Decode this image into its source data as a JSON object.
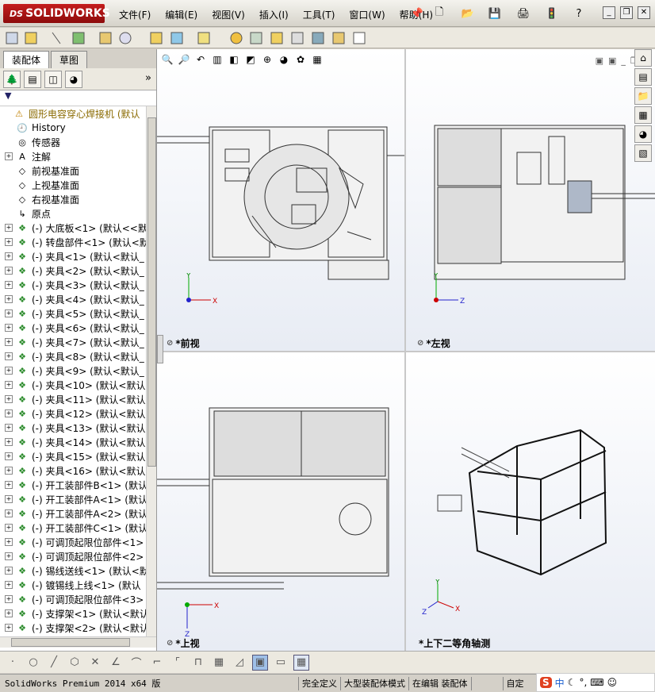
{
  "app": {
    "logo_mark": "DS",
    "logo_text": "SOLIDWORKS"
  },
  "menu": [
    {
      "label": "文件(F)"
    },
    {
      "label": "编辑(E)"
    },
    {
      "label": "视图(V)"
    },
    {
      "label": "插入(I)"
    },
    {
      "label": "工具(T)"
    },
    {
      "label": "窗口(W)"
    },
    {
      "label": "帮助(H)"
    }
  ],
  "fm": {
    "tabs": [
      {
        "label": "装配体"
      },
      {
        "label": "草图"
      }
    ],
    "more": "»",
    "filter": "▼"
  },
  "tree": [
    {
      "label": "圆形电容穿心焊接机  (默认",
      "icon": "assembly-warning-icon",
      "exp": false,
      "root": true
    },
    {
      "label": "History",
      "icon": "history-icon",
      "exp": false
    },
    {
      "label": "传感器",
      "icon": "sensor-icon",
      "exp": false
    },
    {
      "label": "注解",
      "icon": "annotation-icon",
      "exp": true
    },
    {
      "label": "前视基准面",
      "icon": "plane-icon",
      "exp": false
    },
    {
      "label": "上视基准面",
      "icon": "plane-icon",
      "exp": false
    },
    {
      "label": "右视基准面",
      "icon": "plane-icon",
      "exp": false
    },
    {
      "label": "原点",
      "icon": "origin-icon",
      "exp": false
    },
    {
      "label": "(-) 大底板<1> (默认<<默",
      "icon": "part-icon",
      "exp": true
    },
    {
      "label": "(-) 转盘部件<1> (默认<默",
      "icon": "part-icon",
      "exp": true
    },
    {
      "label": "(-) 夹具<1> (默认<默认_",
      "icon": "part-icon",
      "exp": true
    },
    {
      "label": "(-) 夹具<2> (默认<默认_",
      "icon": "part-icon",
      "exp": true
    },
    {
      "label": "(-) 夹具<3> (默认<默认_",
      "icon": "part-icon",
      "exp": true
    },
    {
      "label": "(-) 夹具<4> (默认<默认_",
      "icon": "part-icon",
      "exp": true
    },
    {
      "label": "(-) 夹具<5> (默认<默认_",
      "icon": "part-icon",
      "exp": true
    },
    {
      "label": "(-) 夹具<6> (默认<默认_",
      "icon": "part-icon",
      "exp": true
    },
    {
      "label": "(-) 夹具<7> (默认<默认_",
      "icon": "part-icon",
      "exp": true
    },
    {
      "label": "(-) 夹具<8> (默认<默认_",
      "icon": "part-icon",
      "exp": true
    },
    {
      "label": "(-) 夹具<9> (默认<默认_",
      "icon": "part-icon",
      "exp": true
    },
    {
      "label": "(-) 夹具<10> (默认<默认",
      "icon": "part-icon",
      "exp": true
    },
    {
      "label": "(-) 夹具<11> (默认<默认",
      "icon": "part-icon",
      "exp": true
    },
    {
      "label": "(-) 夹具<12> (默认<默认",
      "icon": "part-icon",
      "exp": true
    },
    {
      "label": "(-) 夹具<13> (默认<默认",
      "icon": "part-icon",
      "exp": true
    },
    {
      "label": "(-) 夹具<14> (默认<默认",
      "icon": "part-icon",
      "exp": true
    },
    {
      "label": "(-) 夹具<15> (默认<默认",
      "icon": "part-icon",
      "exp": true
    },
    {
      "label": "(-) 夹具<16> (默认<默认",
      "icon": "part-icon",
      "exp": true
    },
    {
      "label": "(-) 开工装部件B<1> (默认",
      "icon": "part-icon",
      "exp": true
    },
    {
      "label": "(-) 开工装部件A<1> (默认",
      "icon": "part-icon",
      "exp": true
    },
    {
      "label": "(-) 开工装部件A<2> (默认",
      "icon": "part-icon",
      "exp": true
    },
    {
      "label": "(-) 开工装部件C<1> (默认",
      "icon": "part-icon",
      "exp": true
    },
    {
      "label": "(-) 可调顶起限位部件<1>",
      "icon": "part-icon",
      "exp": true
    },
    {
      "label": "(-) 可调顶起限位部件<2>",
      "icon": "part-icon",
      "exp": true
    },
    {
      "label": "(-) 锡线送线<1> (默认<默",
      "icon": "part-icon",
      "exp": true
    },
    {
      "label": "(-) 镀锡线上线<1> (默认",
      "icon": "part-icon",
      "exp": true
    },
    {
      "label": "(-) 可调顶起限位部件<3>",
      "icon": "part-icon",
      "exp": true
    },
    {
      "label": "(-) 支撑架<1> (默认<默认",
      "icon": "part-icon",
      "exp": true
    },
    {
      "label": "(-) 支撑架<2> (默认<默认",
      "icon": "part-icon",
      "exp": true
    }
  ],
  "viewports": [
    {
      "label": "*前视"
    },
    {
      "label": "*左视"
    },
    {
      "label": "*上视"
    },
    {
      "label": "*上下二等角轴测"
    }
  ],
  "axes": {
    "x": "X",
    "y": "Y",
    "z": "Z"
  },
  "status": {
    "product": "SolidWorks Premium 2014 x64 版",
    "defined": "完全定义",
    "mode": "大型装配体模式",
    "editing": "在编辑 装配体",
    "custom": "自定"
  },
  "ime": {
    "logo": "S",
    "lang": "中"
  }
}
